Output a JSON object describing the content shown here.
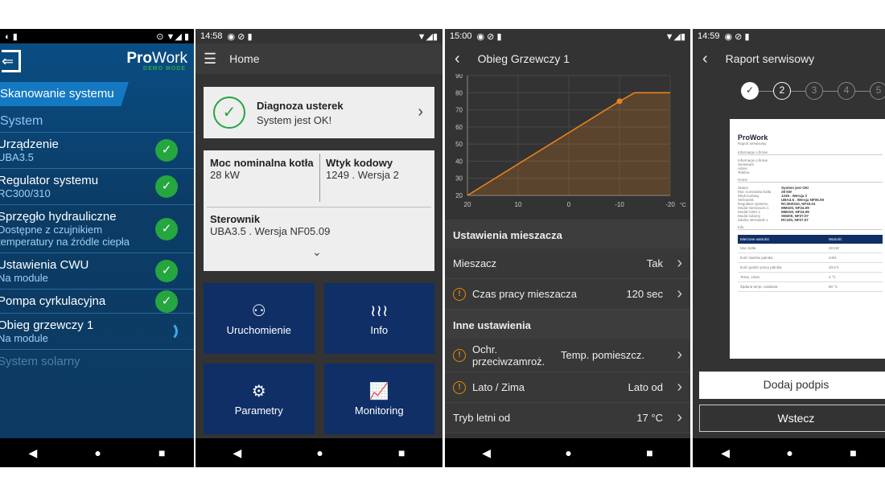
{
  "screen1": {
    "status": {
      "icons": [
        "location-icon",
        "wifi-icon",
        "signal-icon",
        "battery-icon"
      ]
    },
    "logo_bold": "Pro",
    "logo_light": "Work",
    "demo": "DEMO MODE",
    "scan_title": "Skanowanie systemu",
    "section": "System",
    "items": [
      {
        "title": "Urządzenie",
        "sub": "UBA3.5",
        "state": "ok"
      },
      {
        "title": "Regulator systemu",
        "sub": "RC300/310",
        "state": "ok"
      },
      {
        "title": "Sprzęgło hydrauliczne",
        "sub": "Dostępne z czujnikiem temperatury na źródle ciepła",
        "state": "ok"
      },
      {
        "title": "Ustawienia CWU",
        "sub": "Na module",
        "state": "ok"
      },
      {
        "title": "Pompa cyrkulacyjna",
        "sub": "",
        "state": "ok"
      },
      {
        "title": "Obieg grzewczy 1",
        "sub": "Na module",
        "state": "loading"
      }
    ],
    "faded_item": "System solarny"
  },
  "screen2": {
    "time": "14:58",
    "title": "Home",
    "diag_title": "Diagnoza usterek",
    "diag_status": "System jest OK!",
    "moc_label": "Moc nominalna kotła",
    "moc_value": "28 kW",
    "wtyk_label": "Wtyk kodowy",
    "wtyk_value": "1249 . Wersja 2",
    "ster_label": "Sterownik",
    "ster_value": "UBA3.5 . Wersja NF05.09",
    "tiles": [
      {
        "label": "Uruchomienie",
        "icon": "user-gear-icon"
      },
      {
        "label": "Info",
        "icon": "heat-waves-icon"
      },
      {
        "label": "Parametry",
        "icon": "gear-icon"
      },
      {
        "label": "Monitoring",
        "icon": "chart-icon"
      }
    ]
  },
  "screen3": {
    "time": "15:00",
    "title": "Obieg Grzewczy 1",
    "chart_data": {
      "type": "area",
      "x_unit": "°C",
      "xticks": [
        20,
        10,
        0,
        -10,
        -20
      ],
      "yticks": [
        20,
        30,
        40,
        50,
        60,
        70,
        80,
        90
      ],
      "xlim": [
        20,
        -20
      ],
      "ylim": [
        20,
        90
      ],
      "grid": true,
      "color": "#e8821e",
      "points": [
        [
          20,
          20
        ],
        [
          -10,
          75
        ],
        [
          -13,
          80
        ],
        [
          -20,
          80
        ]
      ],
      "marker": [
        -10,
        75
      ]
    },
    "sec1": "Ustawienia mieszacza",
    "mieszacz_label": "Mieszacz",
    "mieszacz_value": "Tak",
    "czas_label": "Czas pracy mieszacza",
    "czas_value": "120 sec",
    "sec2": "Inne ustawienia",
    "ochr_label": "Ochr. przeciwzamroż.",
    "ochr_value": "Temp. pomieszcz.",
    "lato_label": "Lato / Zima",
    "lato_value": "Lato od",
    "tryb_label": "Tryb letni od",
    "tryb_value": "17 °C"
  },
  "screen4": {
    "time": "14:59",
    "title": "Raport serwisowy",
    "steps": [
      "2",
      "3",
      "4",
      "5"
    ],
    "doc": {
      "title": "ProWork",
      "subtitle": "Raport serwisowy",
      "sec_firm": "Informacje o firmie",
      "firm_fields": [
        "Informacje o firmie",
        "Serwisant",
        "Adres",
        "Telefon"
      ],
      "sec_home": "Home",
      "kv": [
        [
          "Status",
          "System jest OK!"
        ],
        [
          "Moc nominalna kotła",
          "28 kW"
        ],
        [
          "Wtyk kodowy",
          "1249 . Wersja 2"
        ],
        [
          "Sterownik",
          "UBA3.5 . Wersja NF05.09"
        ],
        [
          "Regulator systemu",
          "RC300/310, NF33.01"
        ],
        [
          "Moduł mieszacza 1",
          "MM100, NF24.09"
        ],
        [
          "Moduł CWU 1",
          "MM100, NF24.09"
        ],
        [
          "Moduł solarny",
          "SM200, NF27.07"
        ],
        [
          "Zdalny sterownik 1",
          "RC100, NF27.07"
        ]
      ],
      "sec_info": "Info",
      "th": [
        "Mierzone wartości",
        "Wartość"
      ],
      "rows": [
        [
          "Moc kotła",
          "28 kW"
        ],
        [
          "Ilość startów palnika",
          "4491"
        ],
        [
          "Ilość godzin pracy palnika",
          "33.6 h"
        ],
        [
          "Temp. zewn.",
          "4 °C"
        ],
        [
          "Żądana temp. zasilania",
          "80 °C"
        ]
      ]
    },
    "sign_button": "Dodaj podpis",
    "back_button": "Wstecz"
  },
  "colors": {
    "ok_green": "#25a63e",
    "bosch_blue": "#0f2f66",
    "curve_orange": "#e8821e"
  }
}
